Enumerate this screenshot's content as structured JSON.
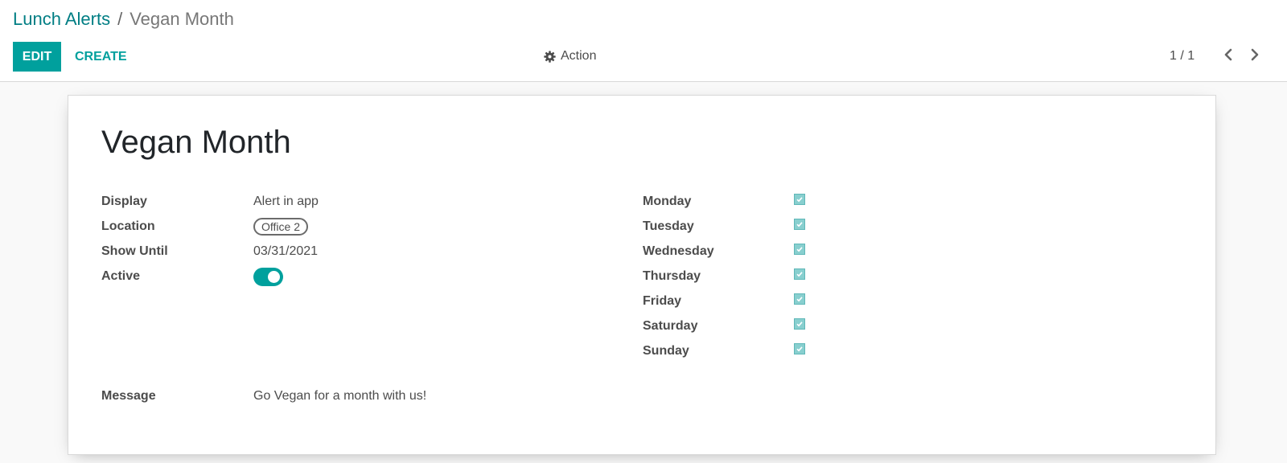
{
  "breadcrumb": {
    "parent": "Lunch Alerts",
    "separator": "/",
    "current": "Vegan Month"
  },
  "toolbar": {
    "edit_label": "EDIT",
    "create_label": "CREATE",
    "action_label": "Action",
    "action_icon": "gear-icon"
  },
  "pager": {
    "value": "1 / 1",
    "prev_icon": "chevron-left-icon",
    "next_icon": "chevron-right-icon"
  },
  "record": {
    "title": "Vegan Month",
    "fields": {
      "display": {
        "label": "Display",
        "value": "Alert in app"
      },
      "location": {
        "label": "Location",
        "value": "Office 2"
      },
      "show_until": {
        "label": "Show Until",
        "value": "03/31/2021"
      },
      "active": {
        "label": "Active",
        "value": true
      },
      "message": {
        "label": "Message",
        "value": "Go Vegan for a month with us!"
      }
    },
    "days": [
      {
        "label": "Monday",
        "checked": true
      },
      {
        "label": "Tuesday",
        "checked": true
      },
      {
        "label": "Wednesday",
        "checked": true
      },
      {
        "label": "Thursday",
        "checked": true
      },
      {
        "label": "Friday",
        "checked": true
      },
      {
        "label": "Saturday",
        "checked": true
      },
      {
        "label": "Sunday",
        "checked": true
      }
    ]
  },
  "colors": {
    "accent": "#00a09d",
    "link": "#017e84",
    "checkbox_fill": "#88cfcf"
  }
}
